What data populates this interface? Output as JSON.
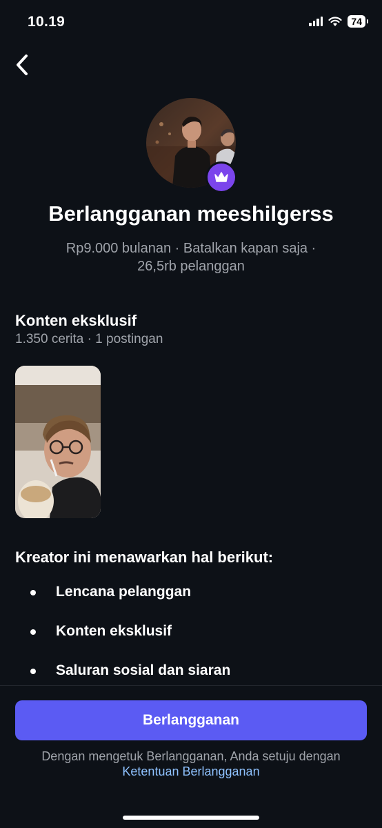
{
  "status_bar": {
    "time": "10.19",
    "battery": "74"
  },
  "profile": {
    "title": "Berlangganan meeshilgerss",
    "meta_line1": "Rp9.000 bulanan · Batalkan kapan saja ·",
    "meta_line2": "26,5rb pelanggan"
  },
  "exclusive": {
    "title": "Konten eksklusif",
    "subtitle": "1.350 cerita · 1 postingan"
  },
  "offers": {
    "title": "Kreator ini menawarkan hal berikut:",
    "items": [
      "Lencana pelanggan",
      "Konten eksklusif",
      "Saluran sosial dan siaran"
    ]
  },
  "cta": {
    "button_label": "Berlangganan",
    "terms_prefix": "Dengan mengetuk Berlangganan, Anda setuju dengan",
    "terms_link": "Ketentuan Berlangganan"
  },
  "colors": {
    "background": "#0d1117",
    "accent": "#5b5bf3",
    "badge": "#7b45ec",
    "link": "#8fc2ff"
  },
  "icons": {
    "back": "chevron-left-icon",
    "badge": "crown-icon"
  }
}
